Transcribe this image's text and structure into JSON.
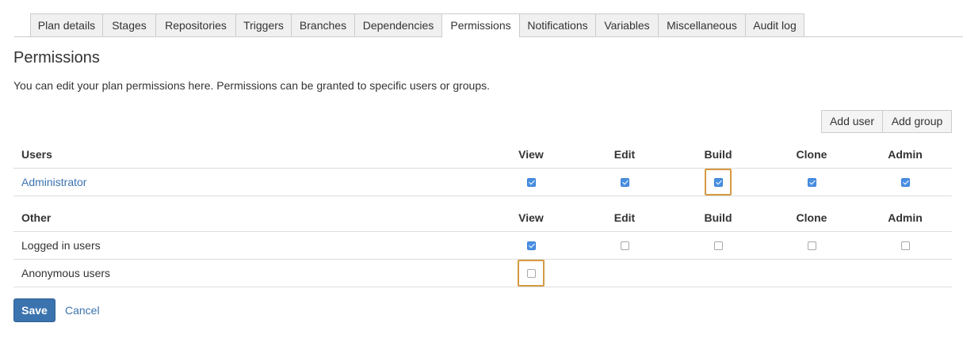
{
  "tabs": [
    {
      "label": "Plan details"
    },
    {
      "label": "Stages"
    },
    {
      "label": "Repositories"
    },
    {
      "label": "Triggers"
    },
    {
      "label": "Branches"
    },
    {
      "label": "Dependencies"
    },
    {
      "label": "Permissions",
      "active": true
    },
    {
      "label": "Notifications"
    },
    {
      "label": "Variables"
    },
    {
      "label": "Miscellaneous"
    },
    {
      "label": "Audit log"
    }
  ],
  "page": {
    "title": "Permissions",
    "description": "You can edit your plan permissions here. Permissions can be granted to specific users or groups."
  },
  "actions": {
    "add_user": "Add user",
    "add_group": "Add group"
  },
  "users_table": {
    "heading": "Users",
    "columns": [
      "View",
      "Edit",
      "Build",
      "Clone",
      "Admin"
    ],
    "rows": [
      {
        "name": "Administrator",
        "view": true,
        "edit": true,
        "build": true,
        "clone": true,
        "admin": true
      }
    ]
  },
  "other_table": {
    "heading": "Other",
    "columns": [
      "View",
      "Edit",
      "Build",
      "Clone",
      "Admin"
    ],
    "rows": [
      {
        "name": "Logged in users",
        "view": true,
        "edit": false,
        "build": false,
        "clone": false,
        "admin": false
      },
      {
        "name": "Anonymous users",
        "view": false
      }
    ]
  },
  "footer": {
    "save": "Save",
    "cancel": "Cancel"
  },
  "colors": {
    "accent": "#3b73af",
    "checkbox_checked": "#4a90e2",
    "highlight": "#d59a43"
  }
}
